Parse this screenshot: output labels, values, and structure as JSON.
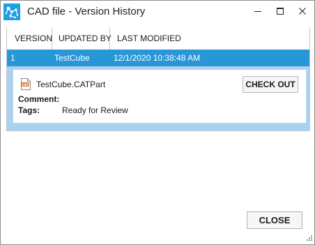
{
  "window": {
    "title": "CAD file - Version History",
    "accent_color": "#2897d8"
  },
  "icons": {
    "app": "app-logo-icon",
    "minimize": "minimize-icon",
    "maximize": "maximize-icon",
    "close": "close-icon",
    "file": "catpart-file-icon",
    "resize": "resize-grip-icon"
  },
  "table": {
    "columns": [
      "VERSION",
      "UPDATED BY",
      "LAST MODIFIED"
    ],
    "rows": [
      {
        "version": "1",
        "updated_by": "TestCube",
        "last_modified": "12/1/2020 10:38:48 AM",
        "selected": true,
        "details": {
          "file_name": "TestCube.CATPart",
          "file_badge": "CAT",
          "checkout_label": "CHECK OUT",
          "comment_label": "Comment:",
          "comment": "",
          "tags_label": "Tags:",
          "tags": "Ready for Review"
        }
      }
    ]
  },
  "footer": {
    "close_label": "CLOSE"
  }
}
